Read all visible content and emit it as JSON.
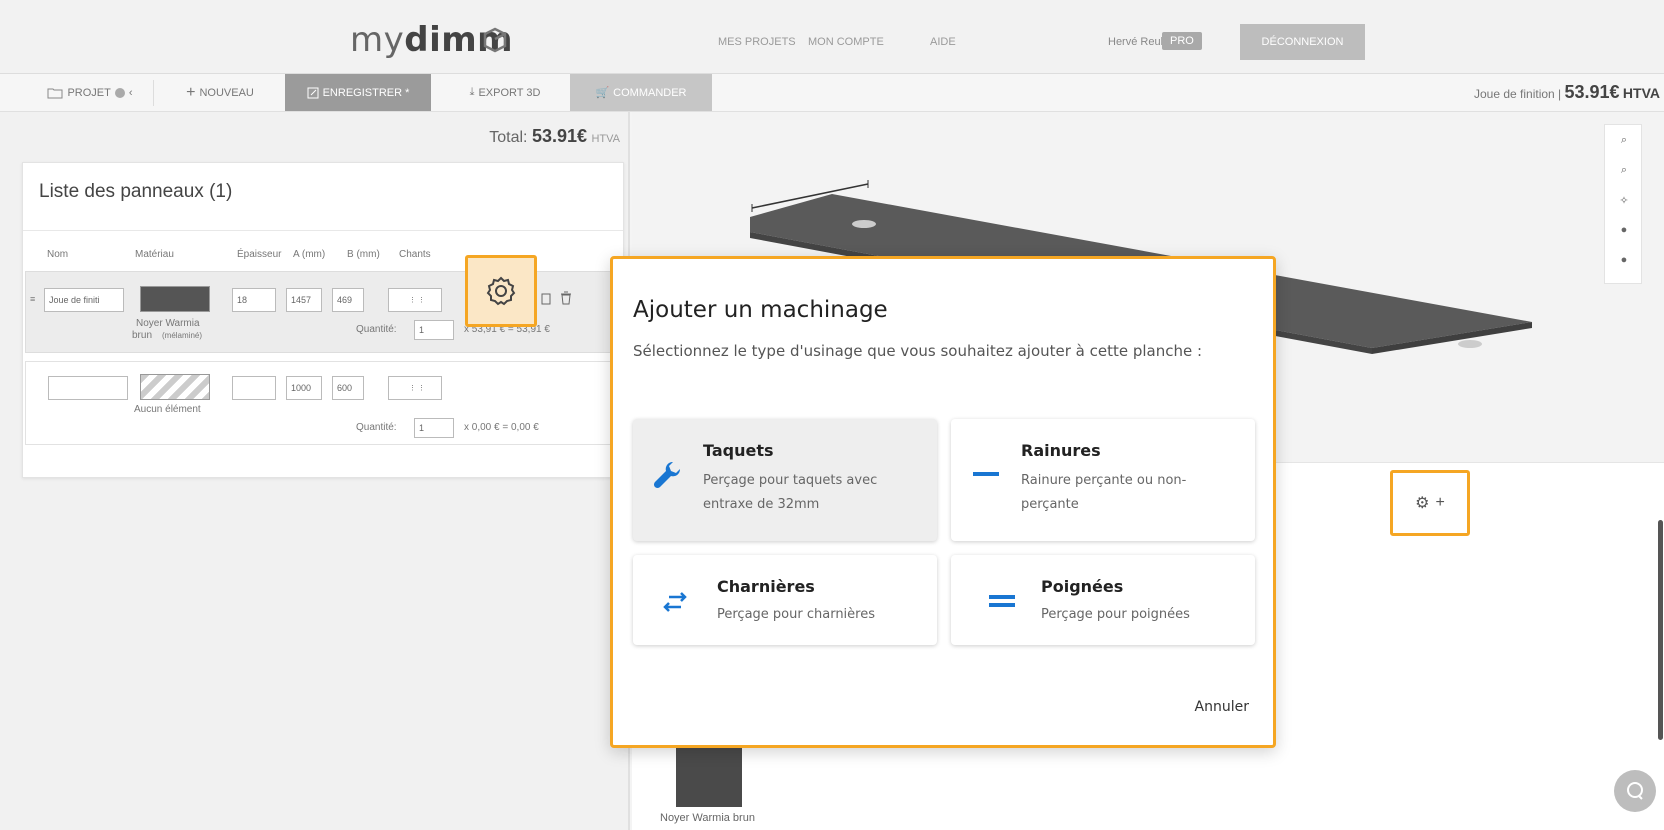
{
  "header": {
    "logo_light": "my",
    "logo_bold": "dimm",
    "nav": [
      "MES PROJETS",
      "MON COMPTE",
      "AIDE"
    ],
    "user_name": "Hervé Reul",
    "badge": "PRO",
    "logout_label": "DÉCONNEXION"
  },
  "toolbar": {
    "project_label": "PROJET",
    "new_label": "NOUVEAU",
    "save_label": "ENREGISTRER *",
    "export_label": "EXPORT 3D",
    "order_label": "COMMANDER",
    "right_item": "Joue de finition |",
    "right_price": "53.91€",
    "right_unit": "HTVA"
  },
  "left_panel": {
    "total_label": "Total:",
    "total_value": "53.91€",
    "total_unit": "HTVA",
    "list_title": "Liste des panneaux (1)",
    "columns": [
      "Nom",
      "Matériau",
      "Épaisseur",
      "A (mm)",
      "B (mm)",
      "Chants"
    ],
    "rows": [
      {
        "name": "Joue de finiti",
        "material_line1": "Noyer Warmia",
        "material_line2": "brun",
        "material_note": "(mélaminé)",
        "thickness": "18",
        "a": "1457",
        "b": "469",
        "qty_label": "Quantité:",
        "qty": "1",
        "price_calc": "x 53,91 € = 53,91 €"
      },
      {
        "name": "",
        "material_line1": "Aucun élément",
        "thickness": "",
        "a": "1000",
        "b": "600",
        "qty_label": "Quantité:",
        "qty": "1",
        "price_calc": "x 0,00 € = 0,00 €"
      }
    ]
  },
  "viewport": {
    "thumb_label": "Noyer Warmia brun"
  },
  "modal": {
    "title": "Ajouter un machinage",
    "description": "Sélectionnez le type d'usinage que vous souhaitez ajouter à cette planche :",
    "options": [
      {
        "title": "Taquets",
        "desc_line1": "Perçage pour taquets avec",
        "desc_line2": "entraxe de 32mm",
        "icon": "wrench-icon"
      },
      {
        "title": "Rainures",
        "desc_line1": "Rainure perçante ou non-",
        "desc_line2": "perçante",
        "icon": "dash-icon"
      },
      {
        "title": "Charnières",
        "desc_line1": "Perçage pour charnières",
        "desc_line2": "",
        "icon": "swap-arrows-icon"
      },
      {
        "title": "Poignées",
        "desc_line1": "Perçage pour poignées",
        "desc_line2": "",
        "icon": "equals-icon"
      }
    ],
    "cancel_label": "Annuler"
  },
  "colors": {
    "highlight": "#f5a623",
    "accent_blue": "#1976d2",
    "panel_wood": "#555555"
  }
}
